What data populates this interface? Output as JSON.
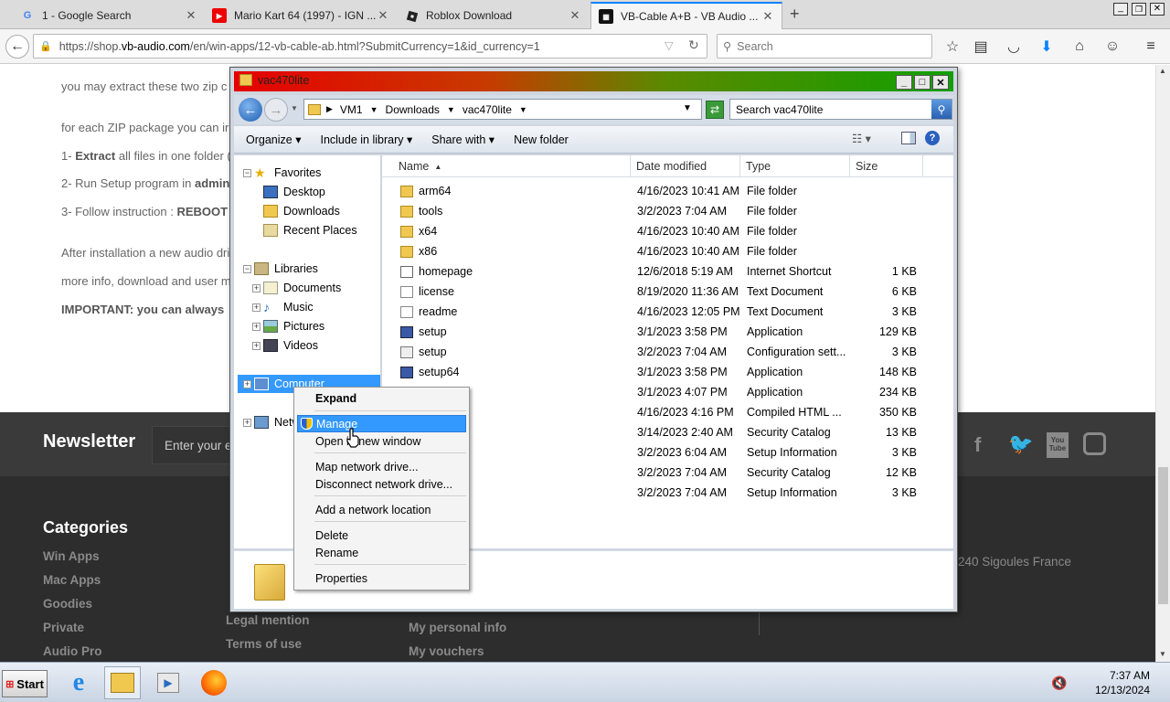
{
  "browser": {
    "tabs": [
      {
        "title": "1 - Google Search",
        "favicon": "google-icon",
        "active": false
      },
      {
        "title": "Mario Kart 64 (1997) - IGN ...",
        "favicon": "youtube-icon",
        "active": false
      },
      {
        "title": "Roblox Download",
        "favicon": "roblox-icon",
        "active": false
      },
      {
        "title": "VB-Cable A+B - VB Audio ...",
        "favicon": "vb-audio-icon",
        "active": true
      }
    ],
    "url_prefix": "https://shop.",
    "url_host": "vb-audio.com",
    "url_rest": "/en/win-apps/12-vb-cable-ab.html?SubmitCurrency=1&id_currency=1",
    "search_placeholder": "Search"
  },
  "webpage": {
    "lines": [
      "you may extract these two zip c",
      "for each ZIP package you can ir",
      "Extract",
      "all files in one folder (",
      "2- Run Setup program in",
      "admin",
      "3- Follow instruction :",
      "REBOOT",
      "After installation a new audio dri",
      "more info, download and user m",
      "IMPORTANT: you can always"
    ],
    "step1_prefix": "1-",
    "newsletter_title": "Newsletter",
    "newsletter_placeholder": "Enter your e",
    "categories_title": "Categories",
    "categories": [
      "Win Apps",
      "Mac Apps",
      "Goodies",
      "Private",
      "Audio Pro"
    ],
    "col2_links": [
      "Legal mention",
      "Terms of use"
    ],
    "col3_links": [
      "My personal info",
      "My vouchers"
    ],
    "address_tail": "240 Sigoules France",
    "colors": {
      "footer_dark": "#2d2d2d",
      "footer_band": "#3a3a3a"
    }
  },
  "explorer": {
    "title": "vac470lite",
    "breadcrumb": [
      "VM1",
      "Downloads",
      "vac470lite"
    ],
    "search_placeholder": "Search vac470lite",
    "commands": [
      "Organize",
      "Include in library",
      "Share with",
      "New folder"
    ],
    "nav": {
      "favorites": "Favorites",
      "favorites_items": [
        "Desktop",
        "Downloads",
        "Recent Places"
      ],
      "libraries": "Libraries",
      "libraries_items": [
        "Documents",
        "Music",
        "Pictures",
        "Videos"
      ],
      "computer": "Computer",
      "network": "Netw"
    },
    "columns": [
      "Name",
      "Date modified",
      "Type",
      "Size"
    ],
    "files": [
      {
        "name": "arm64",
        "date": "4/16/2023 10:41 AM",
        "type": "File folder",
        "size": "",
        "icon": "folder-icon"
      },
      {
        "name": "tools",
        "date": "3/2/2023 7:04 AM",
        "type": "File folder",
        "size": "",
        "icon": "folder-icon"
      },
      {
        "name": "x64",
        "date": "4/16/2023 10:40 AM",
        "type": "File folder",
        "size": "",
        "icon": "folder-icon"
      },
      {
        "name": "x86",
        "date": "4/16/2023 10:40 AM",
        "type": "File folder",
        "size": "",
        "icon": "folder-icon"
      },
      {
        "name": "homepage",
        "date": "12/6/2018 5:19 AM",
        "type": "Internet Shortcut",
        "size": "1 KB",
        "icon": "shortcut-icon"
      },
      {
        "name": "license",
        "date": "8/19/2020 11:36 AM",
        "type": "Text Document",
        "size": "6 KB",
        "icon": "text-file-icon"
      },
      {
        "name": "readme",
        "date": "4/16/2023 12:05 PM",
        "type": "Text Document",
        "size": "3 KB",
        "icon": "text-file-icon"
      },
      {
        "name": "setup",
        "date": "3/1/2023 3:58 PM",
        "type": "Application",
        "size": "129 KB",
        "icon": "app-icon"
      },
      {
        "name": "setup",
        "date": "3/2/2023 7:04 AM",
        "type": "Configuration sett...",
        "size": "3 KB",
        "icon": "config-icon"
      },
      {
        "name": "setup64",
        "date": "3/1/2023 3:58 PM",
        "type": "Application",
        "size": "148 KB",
        "icon": "app-icon"
      },
      {
        "name": "",
        "date": "3/1/2023 4:07 PM",
        "type": "Application",
        "size": "234 KB",
        "icon": ""
      },
      {
        "name": "",
        "date": "4/16/2023 4:16 PM",
        "type": "Compiled HTML ...",
        "size": "350 KB",
        "icon": ""
      },
      {
        "name": "",
        "date": "3/14/2023 2:40 AM",
        "type": "Security Catalog",
        "size": "13 KB",
        "icon": ""
      },
      {
        "name": "",
        "date": "3/2/2023 6:04 AM",
        "type": "Setup Information",
        "size": "3 KB",
        "icon": ""
      },
      {
        "name": "",
        "date": "3/2/2023 7:04 AM",
        "type": "Security Catalog",
        "size": "12 KB",
        "icon": ""
      },
      {
        "name": "",
        "date": "3/2/2023 7:04 AM",
        "type": "Setup Information",
        "size": "3 KB",
        "icon": ""
      }
    ]
  },
  "context_menu": {
    "items": [
      "Expand",
      "Manage",
      "Open in new window",
      "Map network drive...",
      "Disconnect network drive...",
      "Add a network location",
      "Delete",
      "Rename",
      "Properties"
    ],
    "selected": "Manage"
  },
  "taskbar": {
    "start_label": "Start",
    "time": "7:37 AM",
    "date": "12/13/2024"
  }
}
